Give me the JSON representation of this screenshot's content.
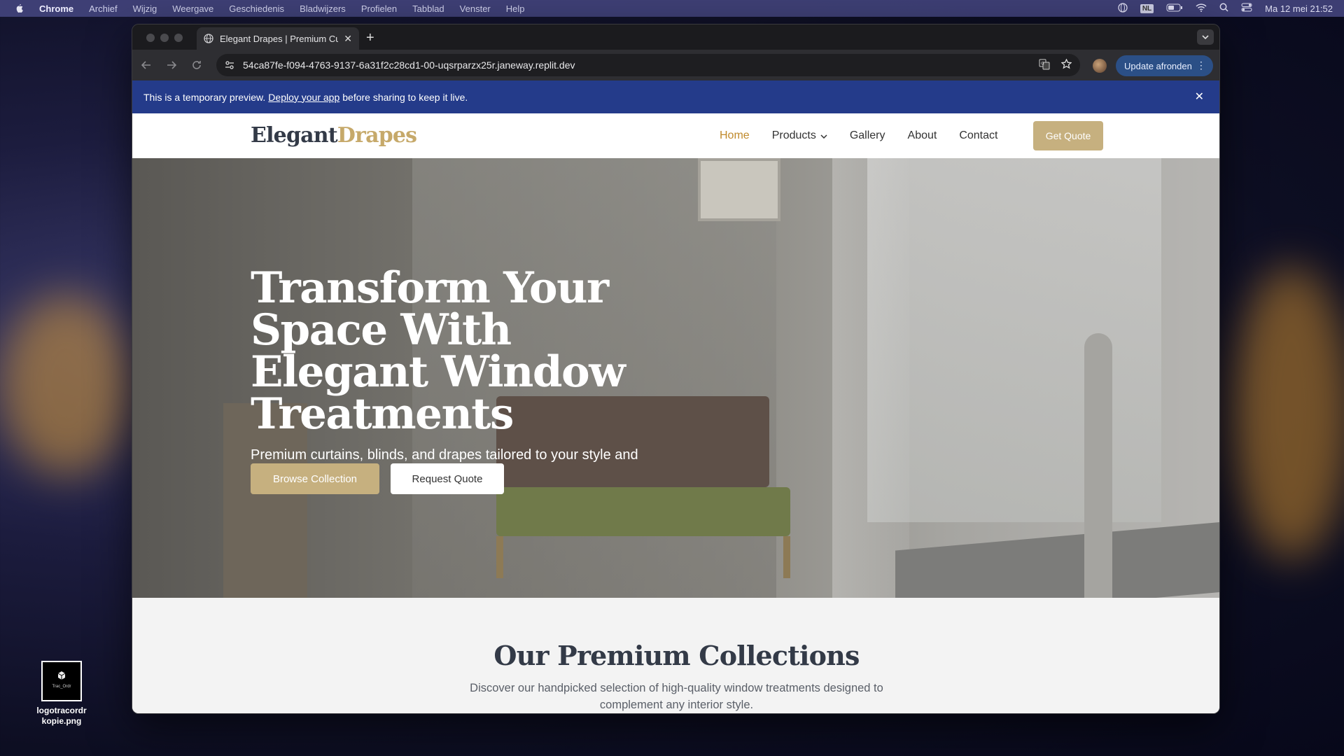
{
  "menubar": {
    "app": "Chrome",
    "items": [
      "Archief",
      "Wijzig",
      "Weergave",
      "Geschiedenis",
      "Bladwijzers",
      "Profielen",
      "Tabblad",
      "Venster",
      "Help"
    ],
    "input_language": "NL",
    "clock": "Ma 12 mei  21:52"
  },
  "desktop": {
    "file_label_line1": "logotracordr",
    "file_label_line2": "kopie.png",
    "thumb_text": "Trac_Ordr"
  },
  "browser": {
    "tab_title": "Elegant Drapes | Premium Cu",
    "url": "54ca87fe-f094-4763-9137-6a31f2c28cd1-00-uqsrparzx25r.janeway.replit.dev",
    "update_label": "Update afronden"
  },
  "banner": {
    "text_before": "This is a temporary preview.",
    "link": "Deploy your app",
    "text_after": "before sharing to keep it live."
  },
  "site": {
    "logo_part1": "Elegant",
    "logo_part2": "Drapes",
    "nav": {
      "home": "Home",
      "products": "Products",
      "gallery": "Gallery",
      "about": "About",
      "contact": "Contact"
    },
    "cta": "Get Quote",
    "hero": {
      "title": "Transform Your Space With Elegant Window Treatments",
      "subtitle": "Premium curtains, blinds, and drapes tailored to your style and needs.",
      "primary_button": "Browse Collection",
      "secondary_button": "Request Quote"
    },
    "collections": {
      "title": "Our Premium Collections",
      "description": "Discover our handpicked selection of high-quality window treatments designed to complement any interior style."
    }
  },
  "colors": {
    "brand_gold": "#c6b07f",
    "nav_active": "#c08a2c",
    "banner_blue": "#243b8a",
    "text_dark": "#333a47"
  }
}
